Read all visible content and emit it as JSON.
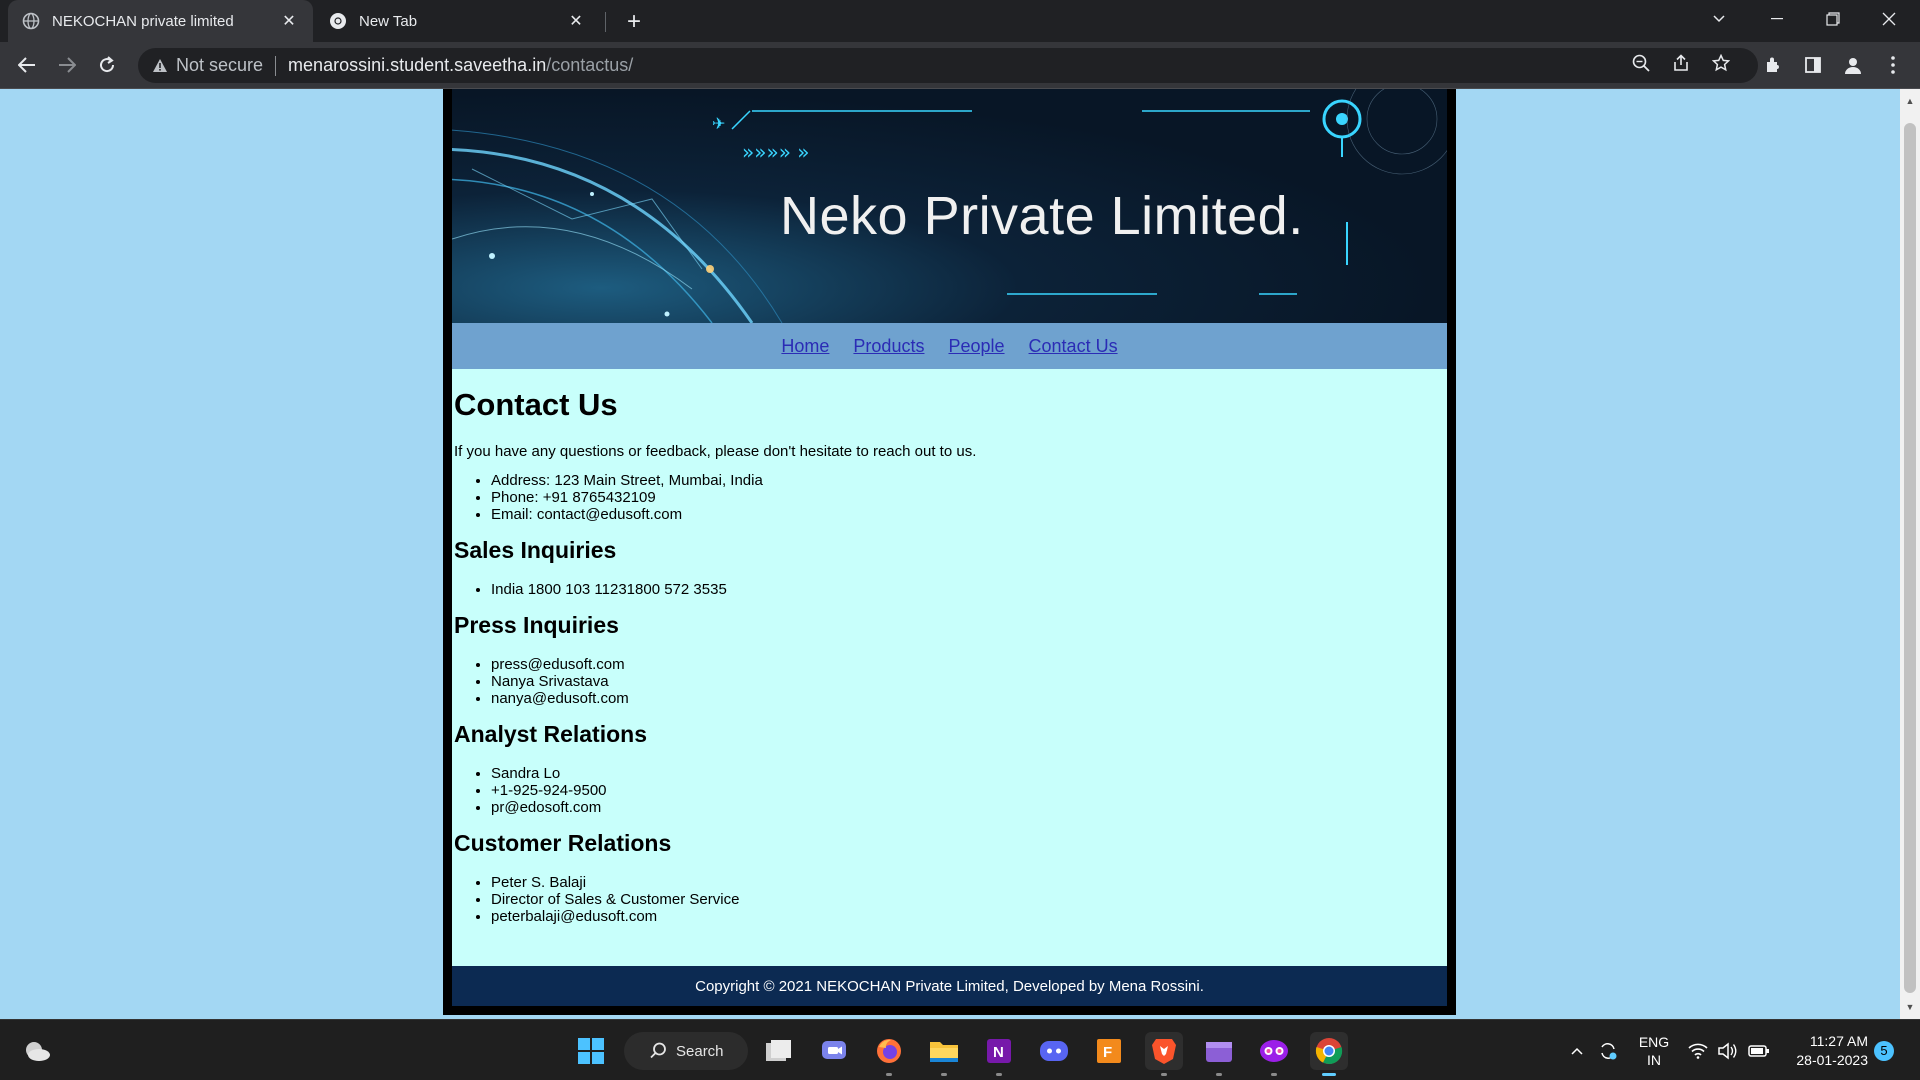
{
  "browser": {
    "tabs": [
      {
        "title": "NEKOCHAN private limited",
        "active": true
      },
      {
        "title": "New Tab",
        "active": false
      }
    ],
    "security_label": "Not secure",
    "url_host": "menarossini.student.saveetha.in",
    "url_path": "/contactus/"
  },
  "page": {
    "banner_title": "Neko Private Limited.",
    "nav": [
      "Home",
      "Products",
      "People",
      "Contact Us"
    ],
    "heading": "Contact Us",
    "intro": "If you have any questions or feedback, please don't hesitate to reach out to us.",
    "contact_items": [
      "Address: 123 Main Street, Mumbai, India",
      "Phone: +91 8765432109",
      "Email: contact@edusoft.com"
    ],
    "sections": [
      {
        "title": "Sales Inquiries",
        "items": [
          "India 1800 103 11231800 572 3535"
        ]
      },
      {
        "title": "Press Inquiries",
        "items": [
          "press@edusoft.com",
          "Nanya Srivastava",
          "nanya@edusoft.com"
        ]
      },
      {
        "title": "Analyst Relations",
        "items": [
          "Sandra Lo",
          "+1-925-924-9500",
          "pr@edosoft.com"
        ]
      },
      {
        "title": "Customer Relations",
        "items": [
          "Peter S. Balaji",
          "Director of Sales & Customer Service",
          "peterbalaji@edusoft.com"
        ]
      }
    ],
    "footer": "Copyright © 2021 NEKOCHAN Private Limited, Developed by Mena Rossini."
  },
  "taskbar": {
    "search_label": "Search",
    "lang_top": "ENG",
    "lang_bottom": "IN",
    "time": "11:27 AM",
    "date": "28-01-2023",
    "notification_count": "5"
  },
  "colors": {
    "page_bg": "#a3d7f3",
    "content_bg": "#c8fffb",
    "nav_bg": "#6fa2cf",
    "link": "#2b2cb5",
    "footer_bg": "#0c2a52"
  }
}
